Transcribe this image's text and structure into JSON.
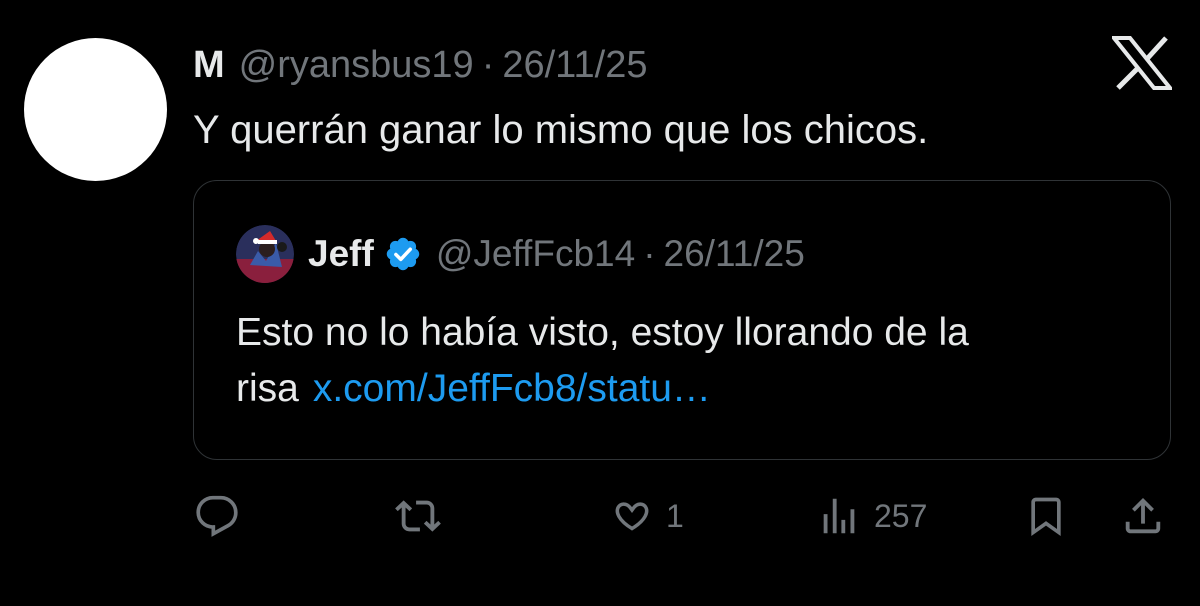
{
  "tweet": {
    "display_name": "M",
    "handle": "@ryansbus19",
    "separator": "·",
    "date": "26/11/25",
    "text": "Y querrán ganar lo mismo que los chicos."
  },
  "quoted_tweet": {
    "display_name": "Jeff",
    "handle": "@JeffFcb14",
    "separator": "·",
    "date": "26/11/25",
    "text": "Esto no lo había visto, estoy llorando de la risa",
    "link": "x.com/JeffFcb8/statu…"
  },
  "actions": {
    "reply_icon": "reply-icon",
    "retweet_icon": "retweet-icon",
    "like_icon": "heart-icon",
    "like_count": "1",
    "views_icon": "analytics-icon",
    "views_count": "257",
    "bookmark_icon": "bookmark-icon",
    "share_icon": "share-icon"
  },
  "colors": {
    "background": "#000000",
    "text": "#e7e9ea",
    "muted": "#71767b",
    "link": "#1d9bf0",
    "verified": "#1d9bf0",
    "border": "#2f3336"
  }
}
